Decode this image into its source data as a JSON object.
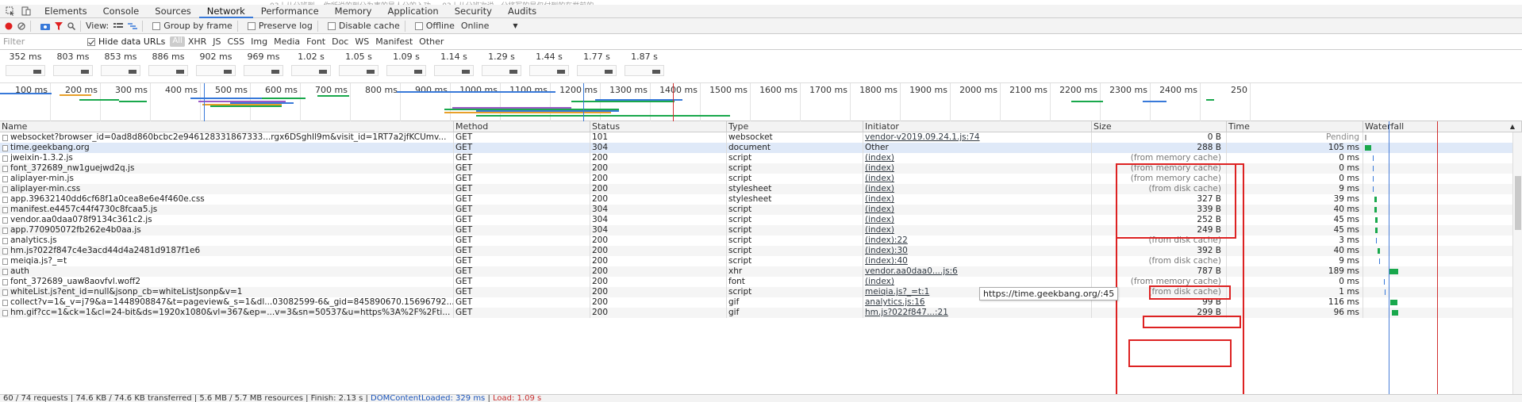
{
  "top_text": "03丨从分班到... 你所说的到分为事的是人分的入功 ... 03丨从分班次说...分将写的是仅付到的在举前的",
  "tabs": [
    {
      "label": "Elements",
      "active": false
    },
    {
      "label": "Console",
      "active": false
    },
    {
      "label": "Sources",
      "active": false
    },
    {
      "label": "Network",
      "active": true
    },
    {
      "label": "Performance",
      "active": false
    },
    {
      "label": "Memory",
      "active": false
    },
    {
      "label": "Application",
      "active": false
    },
    {
      "label": "Security",
      "active": false
    },
    {
      "label": "Audits",
      "active": false
    }
  ],
  "toolbar": {
    "view_label": "View:",
    "group_by_frame": "Group by frame",
    "preserve_log": "Preserve log",
    "disable_cache": "Disable cache",
    "offline": "Offline",
    "throttle": "Online"
  },
  "filter": {
    "placeholder": "Filter",
    "hide_data_urls": "Hide data URLs",
    "types": [
      "All",
      "XHR",
      "JS",
      "CSS",
      "Img",
      "Media",
      "Font",
      "Doc",
      "WS",
      "Manifest",
      "Other"
    ]
  },
  "frames": [
    "352 ms",
    "803 ms",
    "853 ms",
    "886 ms",
    "902 ms",
    "969 ms",
    "1.02 s",
    "1.05 s",
    "1.09 s",
    "1.14 s",
    "1.29 s",
    "1.44 s",
    "1.77 s",
    "1.87 s"
  ],
  "overview_ticks": [
    "100 ms",
    "200 ms",
    "300 ms",
    "400 ms",
    "500 ms",
    "600 ms",
    "700 ms",
    "800 ms",
    "900 ms",
    "1000 ms",
    "1100 ms",
    "1200 ms",
    "1300 ms",
    "1400 ms",
    "1500 ms",
    "1600 ms",
    "1700 ms",
    "1800 ms",
    "1900 ms",
    "2000 ms",
    "2100 ms",
    "2200 ms",
    "2300 ms",
    "2400 ms",
    "250"
  ],
  "columns": [
    "Name",
    "Method",
    "Status",
    "Type",
    "Initiator",
    "Size",
    "Time",
    "Waterfall"
  ],
  "rows": [
    {
      "name": "websocket?browser_id=0ad8d860bcbc2e946128331867333...rgx6DSghIl9m&visit_id=1RT7a2jfKCUmv...",
      "method": "GET",
      "status": "101",
      "type": "websocket",
      "initiator": "vendor-v2019.09.24.1.js:74",
      "init_link": true,
      "size": "0 B",
      "time": "Pending"
    },
    {
      "name": "time.geekbang.org",
      "method": "GET",
      "status": "304",
      "type": "document",
      "initiator": "Other",
      "init_link": false,
      "size": "288 B",
      "time": "105 ms"
    },
    {
      "name": "jweixin-1.3.2.js",
      "method": "GET",
      "status": "200",
      "type": "script",
      "initiator": "(index)",
      "init_link": true,
      "size": "(from memory cache)",
      "time": "0 ms"
    },
    {
      "name": "font_372689_nw1guejwd2q.js",
      "method": "GET",
      "status": "200",
      "type": "script",
      "initiator": "(index)",
      "init_link": true,
      "size": "(from memory cache)",
      "time": "0 ms"
    },
    {
      "name": "aliplayer-min.js",
      "method": "GET",
      "status": "200",
      "type": "script",
      "initiator": "(index)",
      "init_link": true,
      "size": "(from memory cache)",
      "time": "0 ms"
    },
    {
      "name": "aliplayer-min.css",
      "method": "GET",
      "status": "200",
      "type": "stylesheet",
      "initiator": "(index)",
      "init_link": true,
      "size": "(from disk cache)",
      "time": "9 ms"
    },
    {
      "name": "app.39632140dd6cf68f1a0cea8e6e4f460e.css",
      "method": "GET",
      "status": "200",
      "type": "stylesheet",
      "initiator": "(index)",
      "init_link": true,
      "size": "327 B",
      "time": "39 ms"
    },
    {
      "name": "manifest.e4457c44f4730c8fcaa5.js",
      "method": "GET",
      "status": "304",
      "type": "script",
      "initiator": "(index)",
      "init_link": true,
      "size": "339 B",
      "time": "40 ms"
    },
    {
      "name": "vendor.aa0daa078f9134c361c2.js",
      "method": "GET",
      "status": "304",
      "type": "script",
      "initiator": "(index)",
      "init_link": true,
      "size": "252 B",
      "time": "45 ms"
    },
    {
      "name": "app.770905072fb262e4b0aa.js",
      "method": "GET",
      "status": "304",
      "type": "script",
      "initiator": "(index)",
      "init_link": true,
      "size": "249 B",
      "time": "45 ms"
    },
    {
      "name": "analytics.js",
      "method": "GET",
      "status": "200",
      "type": "script",
      "initiator": "(index):22",
      "init_link": true,
      "size": "(from disk cache)",
      "time": "3 ms"
    },
    {
      "name": "hm.js?022f847c4e3acd44d4a2481d9187f1e6",
      "method": "GET",
      "status": "200",
      "type": "script",
      "initiator": "(index):30",
      "init_link": true,
      "size": "392 B",
      "time": "40 ms"
    },
    {
      "name": "meiqia.js?_=t",
      "method": "GET",
      "status": "200",
      "type": "script",
      "initiator": "(index):40",
      "init_link": true,
      "size": "(from disk cache)",
      "time": "9 ms"
    },
    {
      "name": "auth",
      "method": "GET",
      "status": "200",
      "type": "xhr",
      "initiator": "vendor.aa0daa0....js:6",
      "init_link": true,
      "size": "787 B",
      "time": "189 ms"
    },
    {
      "name": "font_372689_uaw8aovfvl.woff2",
      "method": "GET",
      "status": "200",
      "type": "font",
      "initiator": "(index)",
      "init_link": true,
      "size": "(from memory cache)",
      "time": "0 ms"
    },
    {
      "name": "whiteList.js?ent_id=null&jsonp_cb=whiteListJsonp&v=1",
      "method": "GET",
      "status": "200",
      "type": "script",
      "initiator": "meiqia.js?_=t:1",
      "init_link": true,
      "size": "(from disk cache)",
      "time": "1 ms"
    },
    {
      "name": "collect?v=1&_v=j79&a=1448908847&t=pageview&_s=1&dl...03082599-6&_gid=845890670.15696792...",
      "method": "GET",
      "status": "200",
      "type": "gif",
      "initiator": "analytics.js:16",
      "init_link": true,
      "size": "99 B",
      "time": "116 ms"
    },
    {
      "name": "hm.gif?cc=1&ck=1&cl=24-bit&ds=1920x1080&vl=367&ep=...v=3&sn=50537&u=https%3A%2F%2Fti...",
      "method": "GET",
      "status": "200",
      "type": "gif",
      "initiator": "hm.js?022f847...:21",
      "init_link": true,
      "size": "299 B",
      "time": "96 ms"
    }
  ],
  "tooltip": "https://time.geekbang.org/:45",
  "status_bar": {
    "requests": "60 / 74 requests",
    "transferred": "74.6 KB / 74.6 KB transferred",
    "resources": "5.6 MB / 5.7 MB resources",
    "finish": "Finish: 2.13 s",
    "dcl": "DOMContentLoaded: 329 ms",
    "load": "Load: 1.09 s"
  }
}
